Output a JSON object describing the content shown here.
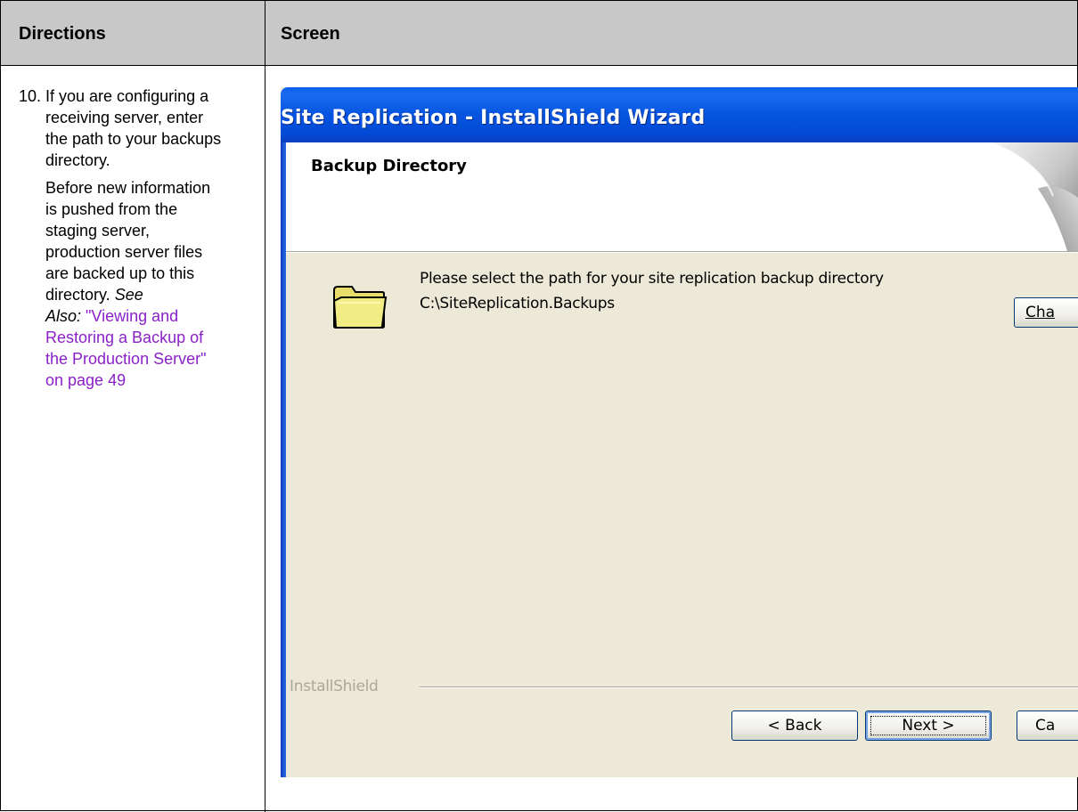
{
  "table": {
    "header_directions": "Directions",
    "header_screen": "Screen"
  },
  "directions": {
    "step_number": "10.",
    "paragraph1": "If you are configuring a receiving server, enter the path to your backups directory.",
    "paragraph2_text": "Before new information is pushed from the staging server, production server files are backed up to this directory.",
    "see_also": "See Also:",
    "link_text": "\"Viewing and Restoring a Backup of the Production Server\" on page 49",
    "link_color": "#8a21c8"
  },
  "wizard": {
    "title": "Site Replication - InstallShield Wizard",
    "banner_title": "Backup Directory",
    "prompt": "Please select the path for your site replication backup directory",
    "path": "C:\\SiteReplication.Backups",
    "change_button": "Cha",
    "brand": "InstallShield",
    "back_button": "< Back",
    "next_button": "Next >",
    "cancel_button": "Ca",
    "icons": [
      "folder-icon",
      "page-curl-graphic"
    ],
    "colors": {
      "titlebar": "#0554e0",
      "dialog_bg": "#ece9d8",
      "button_border": "#003c74"
    }
  }
}
